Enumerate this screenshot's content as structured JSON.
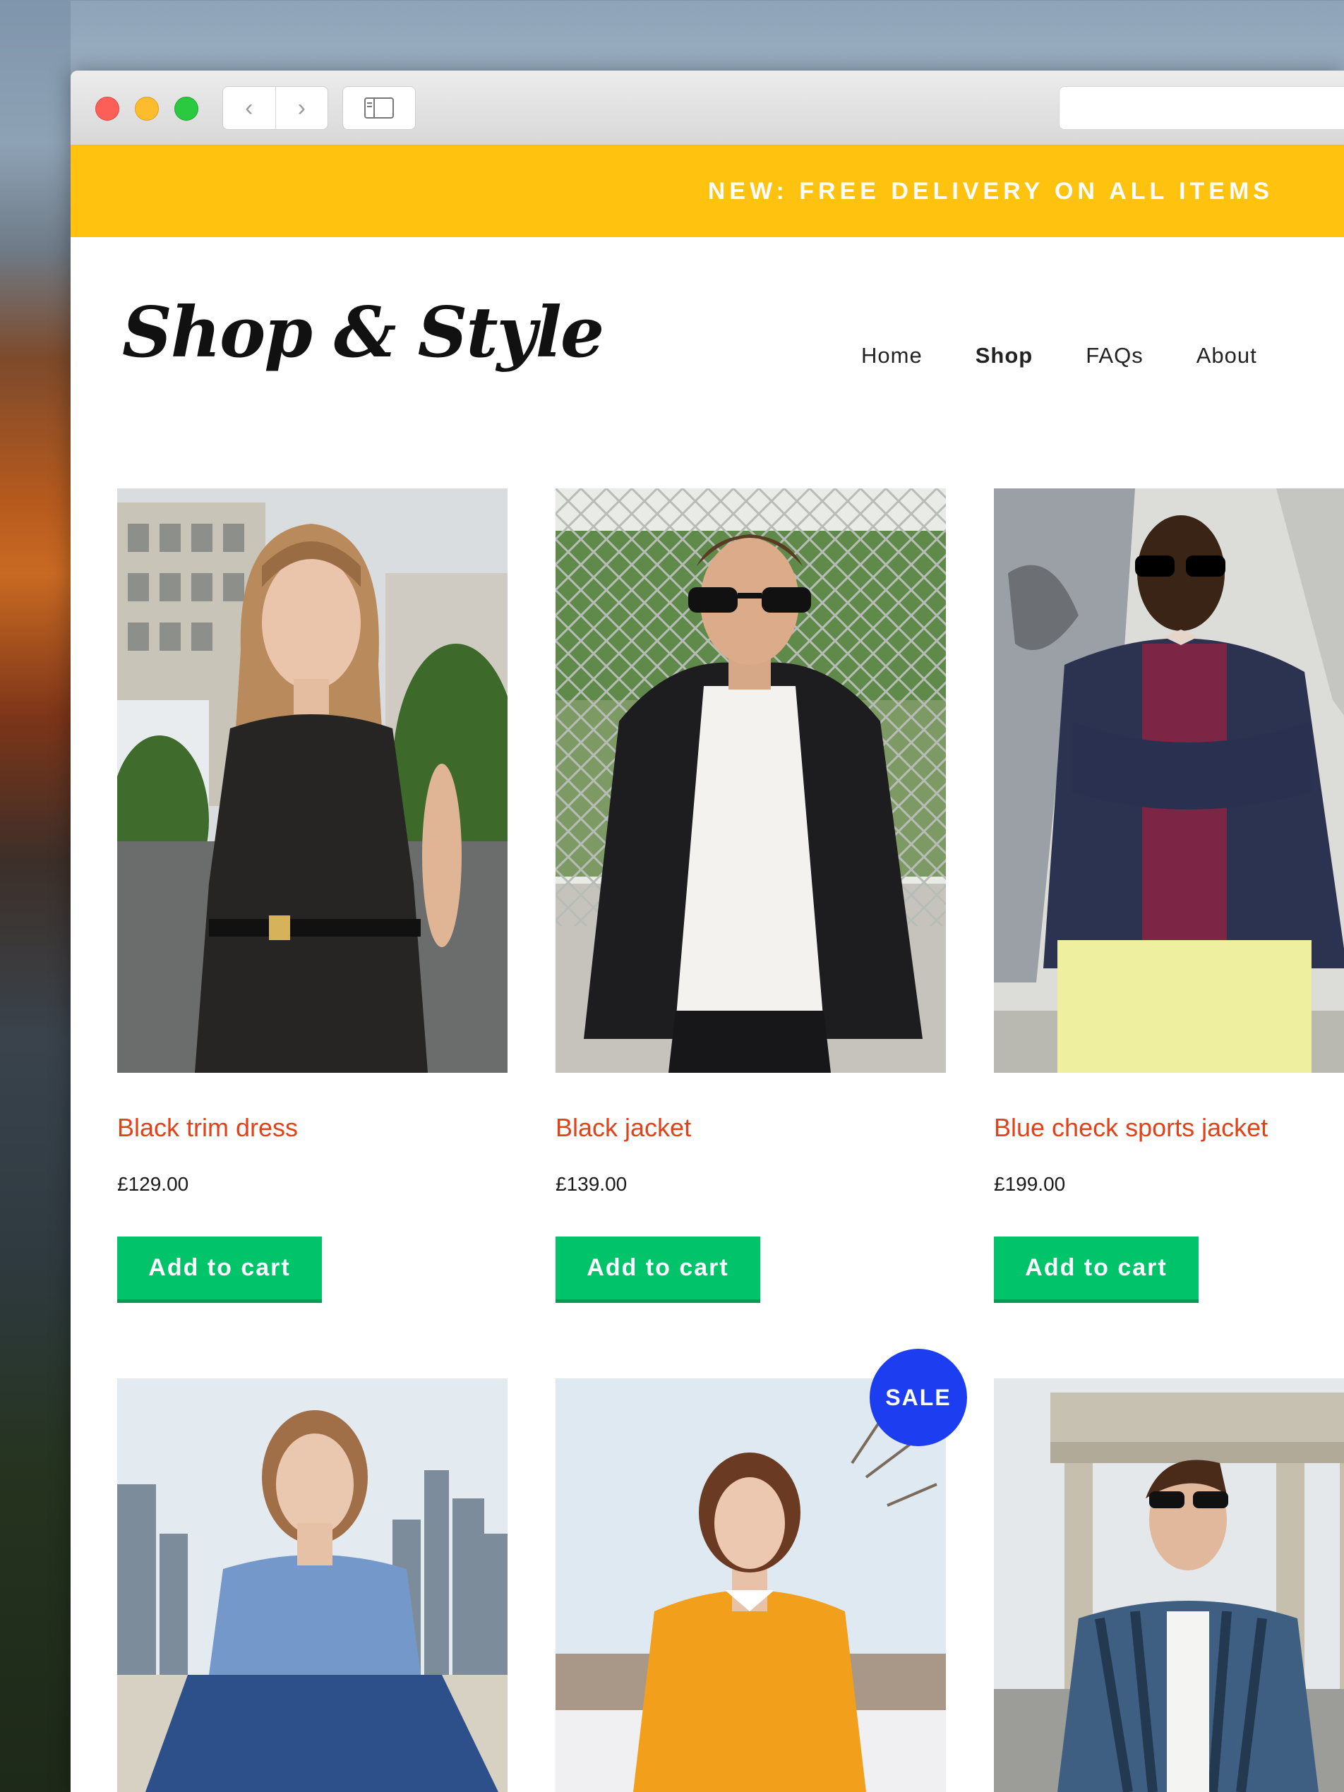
{
  "promo": {
    "text": "NEW: FREE DELIVERY ON ALL ITEMS"
  },
  "brand": {
    "logo_text": "Shop & Style"
  },
  "nav": [
    {
      "label": "Home",
      "active": false
    },
    {
      "label": "Shop",
      "active": true
    },
    {
      "label": "FAQs",
      "active": false
    },
    {
      "label": "About",
      "active": false
    }
  ],
  "products": [
    {
      "name": "Black trim dress",
      "price": "£129.00",
      "button": "Add to cart"
    },
    {
      "name": "Black jacket",
      "price": "£139.00",
      "button": "Add to cart"
    },
    {
      "name": "Blue check sports jacket",
      "price": "£199.00",
      "button": "Add to cart"
    }
  ],
  "badges": {
    "sale": "SALE"
  },
  "colors": {
    "promo_bar": "#ffc20e",
    "product_name": "#e2421a",
    "cart_button": "#00c36a",
    "sale_badge": "#1d3df0"
  }
}
